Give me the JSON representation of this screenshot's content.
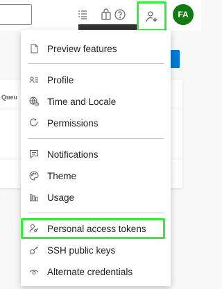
{
  "header": {
    "avatar_initials": "FA"
  },
  "icons": {
    "task_list": "task-list-icon",
    "shopping_bag": "shopping-bag-icon",
    "help": "help-icon",
    "user_settings": "user-settings-icon"
  },
  "background": {
    "column_header": "Queu"
  },
  "menu": {
    "preview_features": "Preview features",
    "profile": "Profile",
    "time_and_locale": "Time and Locale",
    "permissions": "Permissions",
    "notifications": "Notifications",
    "theme": "Theme",
    "usage": "Usage",
    "personal_access_tokens": "Personal access tokens",
    "ssh_public_keys": "SSH public keys",
    "alternate_credentials": "Alternate credentials"
  },
  "colors": {
    "highlight": "#33ee33",
    "avatar_bg": "#107c10",
    "accent_blue": "#0078d4"
  }
}
